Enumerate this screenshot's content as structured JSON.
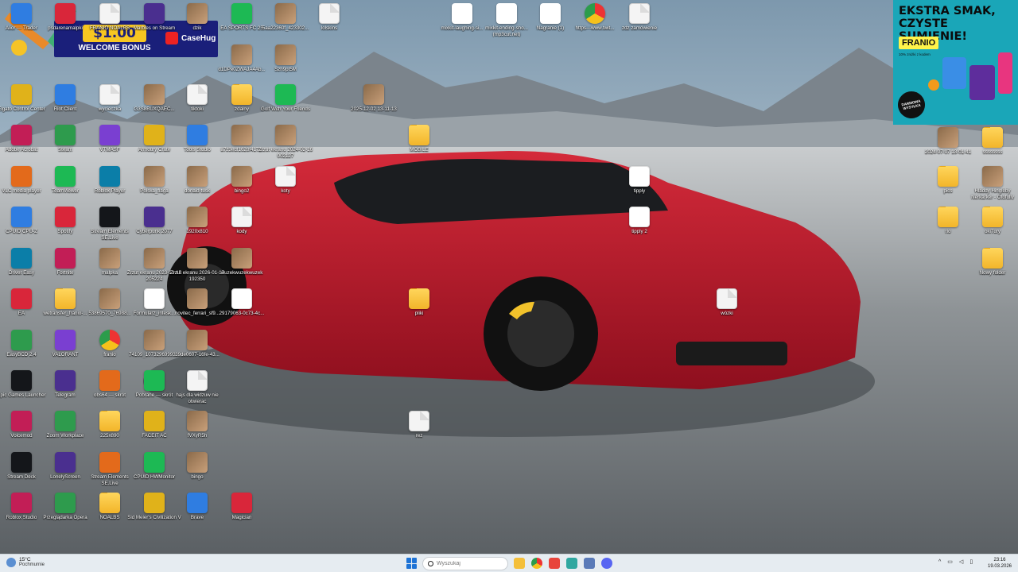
{
  "ads": {
    "casehug": {
      "amount": "$1.00",
      "welcome": "WELCOME BONUS",
      "brand": "CaseHug"
    },
    "franio": {
      "headline": "EKSTRA SMAK, CZYSTE SUMIENIE!",
      "brand": "FRANIO",
      "sub": "10% zniżki z kodem",
      "stamp": "DARMOWA WYSYŁKA"
    }
  },
  "desktop_icons": [
    {
      "label": "Alior — Trader",
      "icon": "app-icon"
    },
    {
      "label": "psdarenamalpki",
      "icon": "app-icon"
    },
    {
      "label": "FRANIO NOALBS",
      "icon": "document-icon"
    },
    {
      "label": "Marbles on Stream",
      "icon": "app-icon"
    },
    {
      "label": "dzik",
      "icon": "image-icon"
    },
    {
      "label": "EA SPORTS FC 25",
      "icon": "app-icon"
    },
    {
      "label": "5aa22360f_423302...",
      "icon": "image-icon"
    },
    {
      "label": "lolskins",
      "icon": "document-icon"
    },
    {
      "label": "d1DPe0ZWAJA4Ab...",
      "icon": "image-icon"
    },
    {
      "label": "Szh9pt5M",
      "icon": "image-icon"
    },
    {
      "label": "Elgato Control Center",
      "icon": "app-icon"
    },
    {
      "label": "Riot Client",
      "icon": "app-icon"
    },
    {
      "label": "wycieczka",
      "icon": "document-icon"
    },
    {
      "label": "G3S8BUXQAEC...",
      "icon": "image-icon"
    },
    {
      "label": "tiktoki",
      "icon": "document-icon"
    },
    {
      "label": "zdalny",
      "icon": "folder-icon"
    },
    {
      "label": "Golf With Your Friends",
      "icon": "app-icon"
    },
    {
      "label": "2025-12-02 13-11-13",
      "icon": "video-icon"
    },
    {
      "label": "Adobe Acrobat",
      "icon": "app-icon"
    },
    {
      "label": "Steam",
      "icon": "app-icon"
    },
    {
      "label": "VTMASF",
      "icon": "app-icon"
    },
    {
      "label": "Armoury Crate",
      "icon": "app-icon"
    },
    {
      "label": "Tools Studio",
      "icon": "app-icon"
    },
    {
      "label": "a7z3edf1628f417...",
      "icon": "image-icon"
    },
    {
      "label": "Zrzut ekranu 2024-02-16 002127",
      "icon": "image-icon"
    },
    {
      "label": "MOBILE",
      "icon": "folder-icon"
    },
    {
      "label": "VLC media player",
      "icon": "app-icon"
    },
    {
      "label": "TeamViewer",
      "icon": "app-icon"
    },
    {
      "label": "Roblox Player",
      "icon": "app-icon"
    },
    {
      "label": "Polska_flaga",
      "icon": "image-icon"
    },
    {
      "label": "donald-tusk",
      "icon": "image-icon"
    },
    {
      "label": "bingo2",
      "icon": "image-icon"
    },
    {
      "label": "koty",
      "icon": "document-icon"
    },
    {
      "label": "CPUID CPU-Z",
      "icon": "app-icon"
    },
    {
      "label": "Spotify",
      "icon": "app-icon"
    },
    {
      "label": "Stream Elements SE.Live",
      "icon": "app-icon"
    },
    {
      "label": "Cyberpunk 2077",
      "icon": "app-icon"
    },
    {
      "label": "1920x810",
      "icon": "image-icon"
    },
    {
      "label": "kody",
      "icon": "document-icon"
    },
    {
      "label": "Driver Easy",
      "icon": "app-icon"
    },
    {
      "label": "Fortnite",
      "icon": "app-icon"
    },
    {
      "label": "malpka",
      "icon": "image-icon"
    },
    {
      "label": "Zrzut ekranu 2023-12-15 205224",
      "icon": "image-icon"
    },
    {
      "label": "Zrzut ekranu 2026-01-17 192350",
      "icon": "image-icon"
    },
    {
      "label": "wuzekwuzekwuzek",
      "icon": "image-icon"
    },
    {
      "label": "EA",
      "icon": "app-icon"
    },
    {
      "label": "wetransfer_franio-...",
      "icon": "folder-icon"
    },
    {
      "label": "53869570_76988...",
      "icon": "image-icon"
    },
    {
      "label": "Formularz_intesk...",
      "icon": "pdf-icon"
    },
    {
      "label": "novitec_ferrari_sf9...",
      "icon": "image-icon"
    },
    {
      "label": "29179063-0c73-4c...",
      "icon": "pdf-icon"
    },
    {
      "label": "pliki",
      "icon": "folder-icon"
    },
    {
      "label": "EasyBCD 2.4",
      "icon": "app-icon"
    },
    {
      "label": "VALORANT",
      "icon": "app-icon"
    },
    {
      "label": "franio",
      "icon": "browser-icon"
    },
    {
      "label": "74109_10732969993...",
      "icon": "image-icon"
    },
    {
      "label": "39de0607-16fe-43...",
      "icon": "image-icon"
    },
    {
      "label": "Epic Games Launcher",
      "icon": "app-icon"
    },
    {
      "label": "Telegram",
      "icon": "app-icon"
    },
    {
      "label": "obs64 — skrót",
      "icon": "app-icon"
    },
    {
      "label": "Pobrane — skrót",
      "icon": "app-icon"
    },
    {
      "label": "hajs dla widzuw nie otwierac",
      "icon": "document-icon"
    },
    {
      "label": "Voicemod",
      "icon": "app-icon"
    },
    {
      "label": "Zoom Workplace",
      "icon": "app-icon"
    },
    {
      "label": "225x890",
      "icon": "folder-icon"
    },
    {
      "label": "FACEIT AC",
      "icon": "app-icon"
    },
    {
      "label": "fVXyR5h",
      "icon": "image-icon"
    },
    {
      "label": "rez",
      "icon": "document-icon"
    },
    {
      "label": "Stream Deck",
      "icon": "app-icon"
    },
    {
      "label": "LonelyScreen",
      "icon": "app-icon"
    },
    {
      "label": "Stream Elements SE.Live",
      "icon": "app-icon"
    },
    {
      "label": "CPUID HWMonitor",
      "icon": "app-icon"
    },
    {
      "label": "bingo",
      "icon": "image-icon"
    },
    {
      "label": "Roblox Studio",
      "icon": "app-icon"
    },
    {
      "label": "Przeglądarka Opera",
      "icon": "app-icon"
    },
    {
      "label": "NOALBS",
      "icon": "folder-icon"
    },
    {
      "label": "Sid Meier's Civilization V",
      "icon": "app-icon"
    },
    {
      "label": "Brave",
      "icon": "app-icon"
    },
    {
      "label": "Magician",
      "icon": "app-icon"
    },
    {
      "label": "mixkit-laughing-si...",
      "icon": "media-icon"
    },
    {
      "label": "mixkit-ending-sho... (mp3cut.net)",
      "icon": "media-icon"
    },
    {
      "label": "Nagranie (1)",
      "icon": "media-icon"
    },
    {
      "label": "https---www.twit...",
      "icon": "browser-icon"
    },
    {
      "label": "zdz zamówienie",
      "icon": "document-icon"
    },
    {
      "label": "tipply",
      "icon": "pdf-icon"
    },
    {
      "label": "tipply 2",
      "icon": "pdf-icon"
    },
    {
      "label": "wózki",
      "icon": "document-icon"
    },
    {
      "label": "2024-07-07 13-01-41",
      "icon": "video-icon"
    },
    {
      "label": "ssssssss",
      "icon": "folder-icon"
    },
    {
      "label": "pics",
      "icon": "folder-icon"
    },
    {
      "label": "Hladdy Hingleby Nerkarker - Otofully",
      "icon": "video-icon"
    },
    {
      "label": "rio",
      "icon": "folder-icon"
    },
    {
      "label": "okiTury",
      "icon": "folder-icon"
    },
    {
      "label": "Nowy folder",
      "icon": "folder-icon"
    }
  ],
  "taskbar": {
    "weather_temp": "15°C",
    "weather_desc": "Pochmurnie",
    "search_placeholder": "Wyszukaj",
    "tray_lang": "^",
    "time": "23:16",
    "date": "19.03.2026"
  }
}
